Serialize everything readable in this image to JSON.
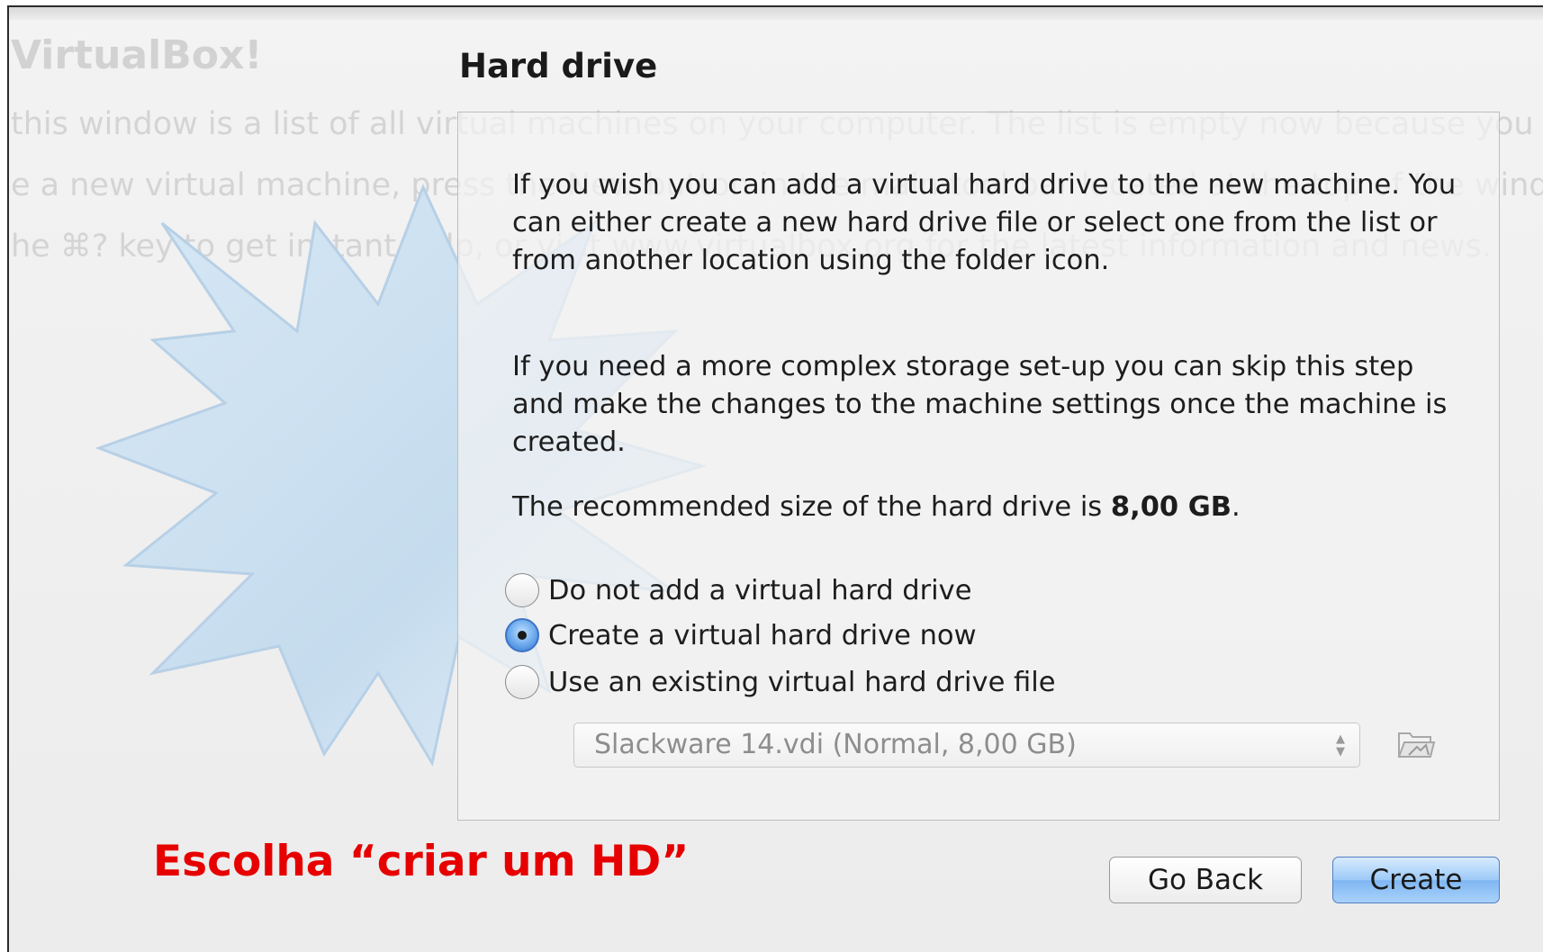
{
  "background": {
    "title": "VirtualBox!",
    "lines": [
      "this window is a list of all virtual machines on your computer. The list is empty now because you have",
      "e a new virtual machine, press the New button in the main tool bar located at the top of the window.",
      "he ⌘? key to get instant help, or visit www.virtualbox.org for the latest information and news."
    ]
  },
  "wizard": {
    "heading": "Hard drive",
    "paragraph1": "If you wish you can add a virtual hard drive to the new machine. You can either create a new hard drive file or select one from the list or from another location using the folder icon.",
    "paragraph2": "If you need a more complex storage set-up you can skip this step and make the changes to the machine settings once the machine is created.",
    "paragraph3_prefix": "The recommended size of the hard drive is ",
    "paragraph3_value": "8,00 GB",
    "paragraph3_suffix": ".",
    "options": [
      {
        "label": "Do not add a virtual hard drive",
        "selected": false
      },
      {
        "label": "Create a virtual hard drive now",
        "selected": true
      },
      {
        "label": "Use an existing virtual hard drive file",
        "selected": false
      }
    ],
    "existing_file_select": {
      "value": "Slackware 14.vdi (Normal, 8,00 GB)",
      "enabled": false
    },
    "folder_icon": "folder-browse-icon",
    "buttons": {
      "back": "Go Back",
      "create": "Create"
    }
  },
  "annotation": {
    "text": "Escolha “criar um HD”",
    "color": "#e60000"
  },
  "colors": {
    "accent": "#3d74c6",
    "create_button": "#9ccaf7"
  }
}
